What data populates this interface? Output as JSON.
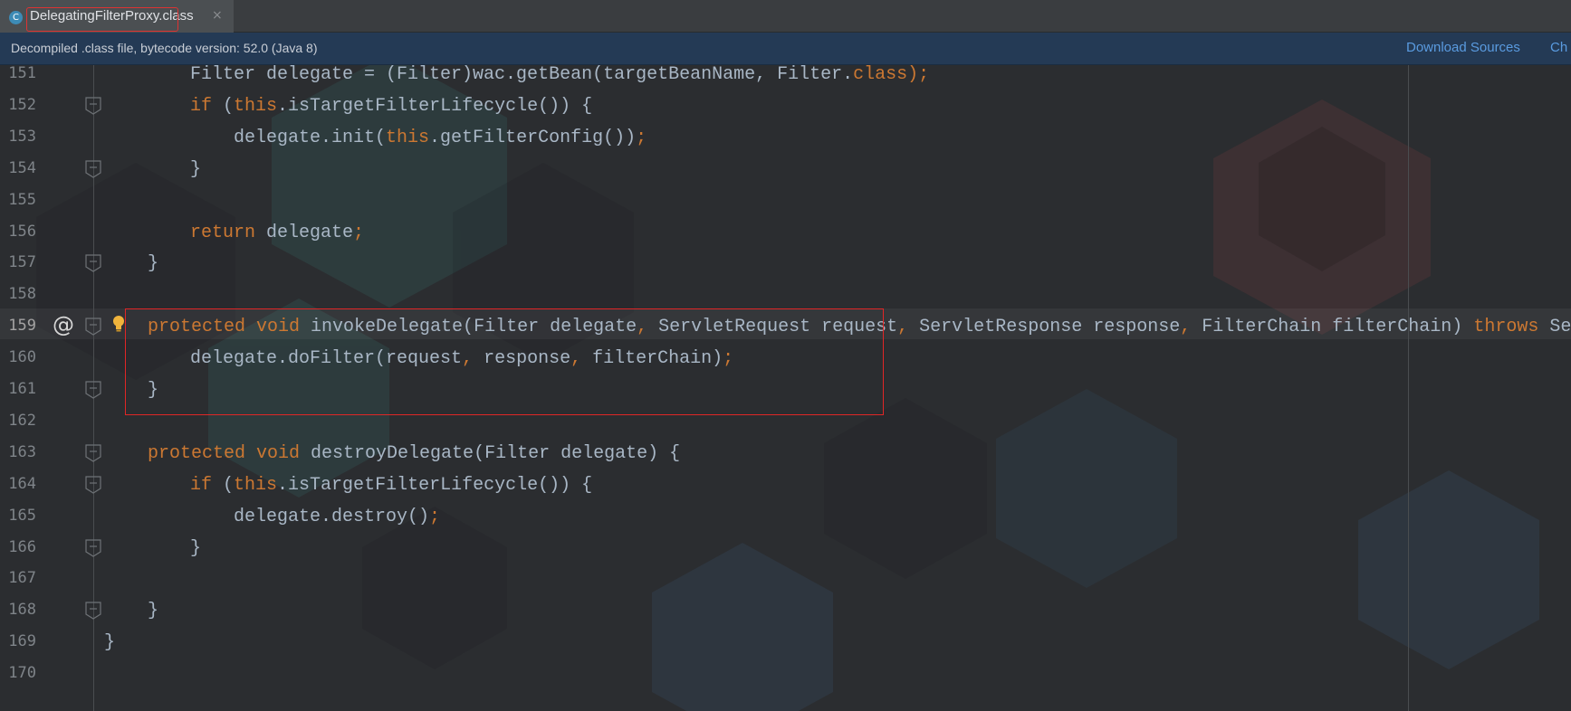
{
  "tab": {
    "icon": "class-file-icon",
    "title": "DelegatingFilterProxy.class",
    "close": "×"
  },
  "banner": {
    "text": "Decompiled .class file, bytecode version: 52.0 (Java 8)",
    "download_sources": "Download Sources",
    "choose_sources": "Ch"
  },
  "editor": {
    "current_line": "159",
    "lines": [
      {
        "n": "151",
        "tokens": [
          {
            "t": "Filter delegate = (Filter)wac.getBean(targetBeanName, Filter.",
            "c": "id"
          },
          {
            "t": "class",
            "c": "kw"
          },
          {
            "t": ");",
            "c": "op"
          }
        ]
      },
      {
        "n": "152",
        "tokens": [
          {
            "t": "if",
            "c": "kw"
          },
          {
            "t": " (",
            "c": "id"
          },
          {
            "t": "this",
            "c": "kw"
          },
          {
            "t": ".isTargetFilterLifecycle()) {",
            "c": "id"
          }
        ]
      },
      {
        "n": "153",
        "tokens": [
          {
            "t": "delegate.init(",
            "c": "id"
          },
          {
            "t": "this",
            "c": "kw"
          },
          {
            "t": ".getFilterConfig())",
            "c": "id"
          },
          {
            "t": ";",
            "c": "op"
          }
        ]
      },
      {
        "n": "154",
        "tokens": [
          {
            "t": "}",
            "c": "id"
          }
        ]
      },
      {
        "n": "155",
        "tokens": []
      },
      {
        "n": "156",
        "tokens": [
          {
            "t": "return",
            "c": "kw"
          },
          {
            "t": " delegate",
            "c": "id"
          },
          {
            "t": ";",
            "c": "op"
          }
        ]
      },
      {
        "n": "157",
        "tokens": [
          {
            "t": "}",
            "c": "id"
          }
        ]
      },
      {
        "n": "158",
        "tokens": []
      },
      {
        "n": "159",
        "tokens": [
          {
            "t": "protected void",
            "c": "kw"
          },
          {
            "t": " invokeDelegate(Filter delegate",
            "c": "id"
          },
          {
            "t": ",",
            "c": "op"
          },
          {
            "t": " ServletRequest request",
            "c": "id"
          },
          {
            "t": ",",
            "c": "op"
          },
          {
            "t": " ServletResponse response",
            "c": "id"
          },
          {
            "t": ",",
            "c": "op"
          },
          {
            "t": " FilterChain filterChain) ",
            "c": "id"
          },
          {
            "t": "throws",
            "c": "kw"
          },
          {
            "t": " Se",
            "c": "id"
          }
        ]
      },
      {
        "n": "160",
        "tokens": [
          {
            "t": "delegate.doFilter(request",
            "c": "id"
          },
          {
            "t": ",",
            "c": "op"
          },
          {
            "t": " response",
            "c": "id"
          },
          {
            "t": ",",
            "c": "op"
          },
          {
            "t": " filterChain)",
            "c": "id"
          },
          {
            "t": ";",
            "c": "op"
          }
        ]
      },
      {
        "n": "161",
        "tokens": [
          {
            "t": "}",
            "c": "id"
          }
        ]
      },
      {
        "n": "162",
        "tokens": []
      },
      {
        "n": "163",
        "tokens": [
          {
            "t": "protected void",
            "c": "kw"
          },
          {
            "t": " destroyDelegate(Filter delegate) {",
            "c": "id"
          }
        ]
      },
      {
        "n": "164",
        "tokens": [
          {
            "t": "if",
            "c": "kw"
          },
          {
            "t": " (",
            "c": "id"
          },
          {
            "t": "this",
            "c": "kw"
          },
          {
            "t": ".isTargetFilterLifecycle()) {",
            "c": "id"
          }
        ]
      },
      {
        "n": "165",
        "tokens": [
          {
            "t": "delegate.destroy()",
            "c": "id"
          },
          {
            "t": ";",
            "c": "op"
          }
        ]
      },
      {
        "n": "166",
        "tokens": [
          {
            "t": "}",
            "c": "id"
          }
        ]
      },
      {
        "n": "167",
        "tokens": []
      },
      {
        "n": "168",
        "tokens": [
          {
            "t": "}",
            "c": "id"
          }
        ]
      },
      {
        "n": "169",
        "tokens": [
          {
            "t": "}",
            "c": "id"
          }
        ]
      },
      {
        "n": "170",
        "tokens": []
      }
    ],
    "at_marker": "@"
  }
}
